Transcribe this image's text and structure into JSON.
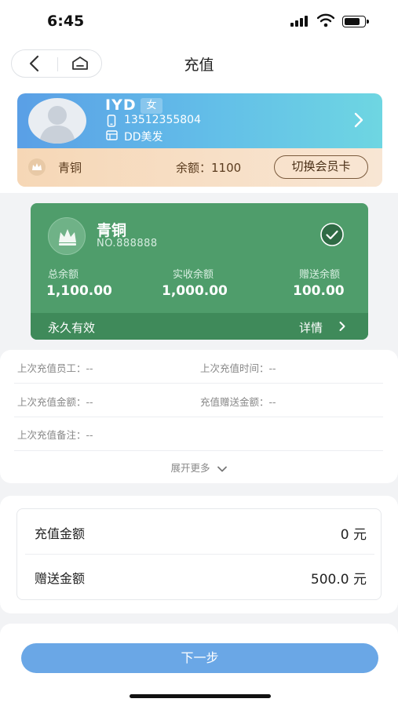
{
  "status_bar": {
    "time": "6:45"
  },
  "nav": {
    "title": "充值"
  },
  "member": {
    "name": "IYD",
    "gender": "女",
    "phone": "13512355804",
    "store": "DD美发",
    "level": "青铜",
    "balance": "余额：1100",
    "switch_card_label": "切换会员卡"
  },
  "card": {
    "level": "青铜",
    "number": "NO.888888",
    "stats": [
      {
        "label": "总余额",
        "value": "1,100.00"
      },
      {
        "label": "实收余额",
        "value": "1,000.00"
      },
      {
        "label": "赠送余额",
        "value": "100.00"
      }
    ],
    "validity": "永久有效",
    "details_label": "详情"
  },
  "last_recharge": {
    "staff": "上次充值员工：--",
    "time": "上次充值时间：--",
    "amount": "上次充值金额：--",
    "bonus": "充值赠送金额：--",
    "note": "上次充值备注：--",
    "expand_label": "展开更多"
  },
  "amount": {
    "recharge_label": "充值金额",
    "recharge_value": "0 元",
    "bonus_label": "赠送金额",
    "bonus_value": "500.0 元"
  },
  "footer": {
    "next_label": "下一步"
  },
  "colors": {
    "accent_blue": "#6aa7e6",
    "card_green": "#4f9d6b",
    "bronze": "#f6d7b6"
  }
}
